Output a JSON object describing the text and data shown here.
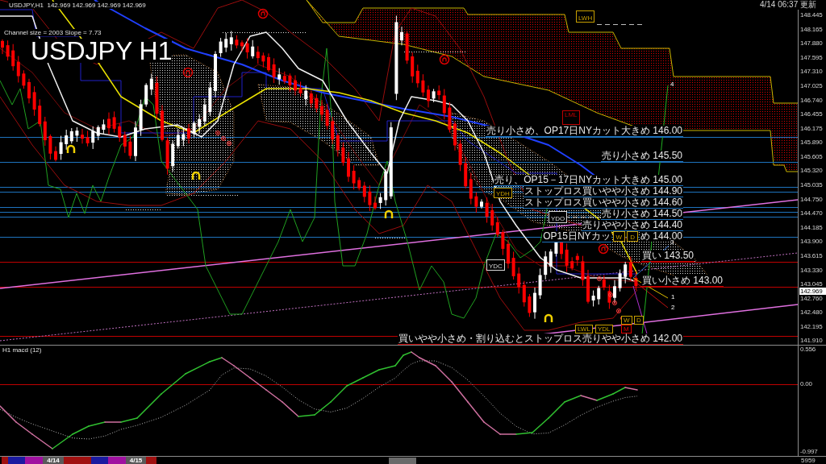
{
  "chart_header": {
    "symbol_line": "USDJPY,H1  142.969 142.969 142.969 142.969",
    "channel_info": "Channel size = 2003 Slope = 7.73",
    "title": "USDJPY H1",
    "updated": "4/14 06:37 更新"
  },
  "price_axis": {
    "labels": [
      "148.445",
      "148.165",
      "147.880",
      "147.595",
      "147.310",
      "147.025",
      "146.740",
      "146.455",
      "146.175",
      "145.890",
      "145.605",
      "145.320",
      "145.035",
      "144.750",
      "144.470",
      "144.185",
      "143.900",
      "143.615",
      "143.330",
      "143.045",
      "142.760",
      "142.480",
      "142.195",
      "141.910"
    ],
    "current_price": "142.969"
  },
  "levels": [
    {
      "label": "売り小さめ、OP17日NYカット大きめ 146.00",
      "color": "#1e73be"
    },
    {
      "label": "売り小さめ 145.50",
      "color": "#1e73be"
    },
    {
      "label": "売り、OP15－17日NYカット大きめ 145.00",
      "color": "#1e73be"
    },
    {
      "label": "ストップロス買いやや小さめ 144.90",
      "color": "#1e73be"
    },
    {
      "label": "ストップロス買いやや小さめ 144.60",
      "color": "#1e73be"
    },
    {
      "label": "売り小さめ 144.50",
      "color": "#1e73be"
    },
    {
      "label": "売りやや小さめ 144.40",
      "color": "#1e73be"
    },
    {
      "label": "OP15日NYカッ",
      "label_after": "め 144.00",
      "color": "#1e73be"
    },
    {
      "label": "買い 143.50",
      "color": "#c00000"
    },
    {
      "label": "買い小さめ 143.00",
      "color": "#c00000"
    },
    {
      "label": "買いやや小さめ・割り込むとストップロス売りやや小さめ 142.00",
      "color": "#c00000"
    }
  ],
  "markers": [
    {
      "text": "LWH",
      "color": "#c8a000"
    },
    {
      "text": "LML",
      "color": "#c00000"
    },
    {
      "text": "YDH",
      "color": "#c8a000"
    },
    {
      "text": "YDO",
      "color": "#d8d8d8"
    },
    {
      "text": "W",
      "color": "#c8a000"
    },
    {
      "text": "D",
      "color": "#c8a000"
    },
    {
      "text": "YDC",
      "color": "#d8d8d8"
    },
    {
      "text": "W",
      "color": "#c8a000"
    },
    {
      "text": "D",
      "color": "#c8a000"
    },
    {
      "text": "LWL",
      "color": "#c8a000"
    },
    {
      "text": "YDL",
      "color": "#c8a000"
    },
    {
      "text": "M",
      "color": "#e00000"
    }
  ],
  "projection_labels": [
    "4",
    "3",
    "1",
    "2"
  ],
  "macd": {
    "title": "H1 macd (12)",
    "axis_labels": [
      "0.556",
      "0.00",
      "-0.997"
    ]
  },
  "sessions": [
    {
      "color": "#a01010"
    },
    {
      "color": "#1a1aa0"
    },
    {
      "color": "#a010a0"
    },
    {
      "color": "#5a5a5a",
      "label": "4/14"
    },
    {
      "color": "#a01010"
    },
    {
      "color": "#1a1aa0"
    },
    {
      "color": "#a010a0"
    },
    {
      "color": "#5a5a5a",
      "label": "4/15"
    },
    {
      "color": "#a01010"
    }
  ],
  "time_bar": {
    "corner_label": "5959"
  }
}
